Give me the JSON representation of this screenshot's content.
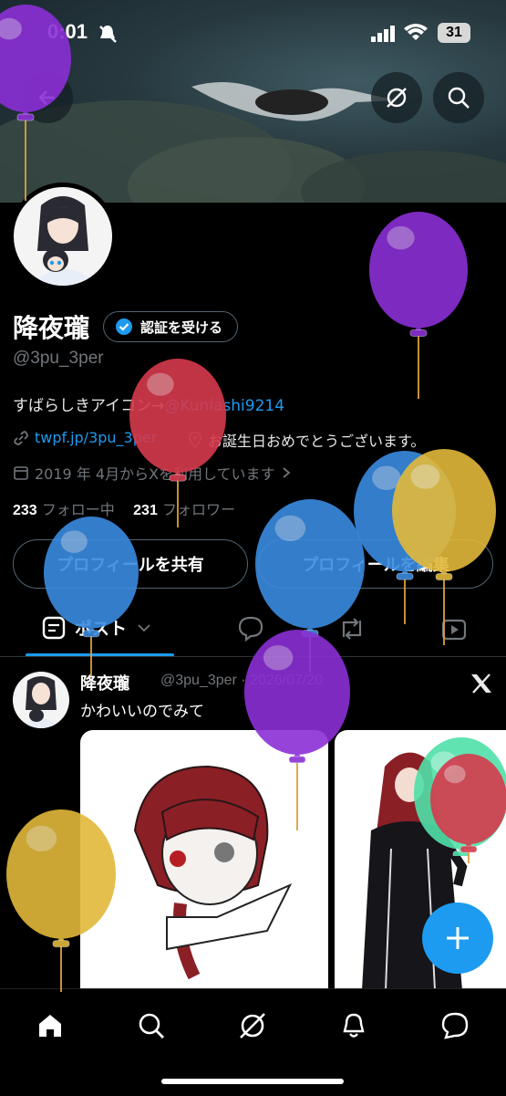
{
  "status_bar": {
    "time": "0:01",
    "battery": "31"
  },
  "profile": {
    "display_name": "降夜瓏",
    "verify_label": "認証を受ける",
    "handle": "@3pu_3per",
    "bio_prefix": "すばらしきアイコン→",
    "bio_mention": "@Kuniashi9214",
    "website": "twpf.jp/3pu_3per",
    "location": "お誕生日おめでとうございます。",
    "joined": "2019 年 4月からXを利用しています",
    "following_count": "233",
    "following_label": "フォロー中",
    "followers_count": "231",
    "followers_label": "フォロワー"
  },
  "actions": {
    "share_label": "プロフィールを共有",
    "edit_label": "プロフィールを編集"
  },
  "tabs": {
    "posts_label": "ポスト"
  },
  "post": {
    "author": "降夜瓏",
    "handle": "@3pu_3per",
    "date": "2026/07/20",
    "text": "かわいいのでみて"
  },
  "icons": [
    "back-arrow-icon",
    "grok-icon",
    "search-icon",
    "verified-badge-icon",
    "link-icon",
    "location-icon",
    "calendar-icon",
    "chevron-right-icon",
    "posts-icon",
    "chevron-down-icon",
    "reply-icon",
    "repost-icon",
    "video-icon",
    "x-logo-icon",
    "plus-icon",
    "home-icon",
    "bell-icon",
    "messages-icon",
    "balloon-icon"
  ],
  "colors": {
    "accent": "#1d9bf0",
    "background": "#000000",
    "muted": "#71767b",
    "balloon_purple": "#8b2fd6",
    "balloon_red": "#d63a4d",
    "balloon_blue": "#3a8be0",
    "balloon_yellow": "#e2b93a",
    "balloon_green": "#4fe0a8"
  }
}
